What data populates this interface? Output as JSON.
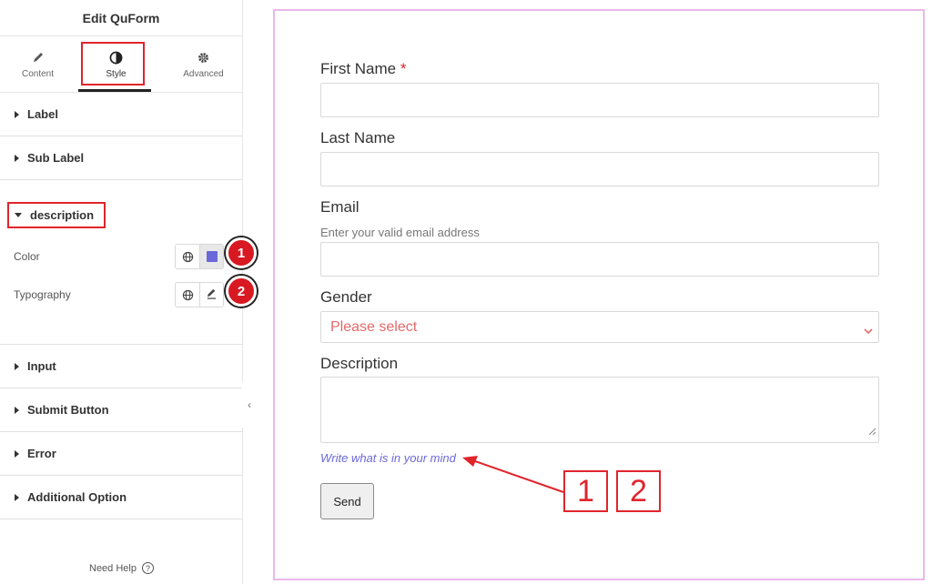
{
  "sidebar": {
    "title": "Edit QuForm",
    "tabs": [
      {
        "label": "Content",
        "icon": "pencil-icon"
      },
      {
        "label": "Style",
        "icon": "contrast-icon"
      },
      {
        "label": "Advanced",
        "icon": "gear-icon"
      }
    ],
    "sections_top": [
      "Label",
      "Sub Label"
    ],
    "open_section": "description",
    "controls": {
      "color_label": "Color",
      "color_value": "#6a68d9",
      "typography_label": "Typography"
    },
    "sections_bottom": [
      "Input",
      "Submit Button",
      "Error",
      "Additional Option"
    ],
    "need_help": "Need Help",
    "help_glyph": "?",
    "collapse_glyph": "‹"
  },
  "badges": [
    "1",
    "2"
  ],
  "form": {
    "first_name_label": "First Name",
    "required_mark": "*",
    "last_name_label": "Last Name",
    "email_label": "Email",
    "email_help": "Enter your valid email address",
    "gender_label": "Gender",
    "gender_placeholder": "Please select",
    "description_label": "Description",
    "description_help": "Write what is in your mind",
    "send_label": "Send"
  },
  "callouts": [
    "1",
    "2"
  ],
  "colors": {
    "accent_red": "#e0252b",
    "description_color": "#6a68d9",
    "preview_border": "#e9b8ea"
  }
}
